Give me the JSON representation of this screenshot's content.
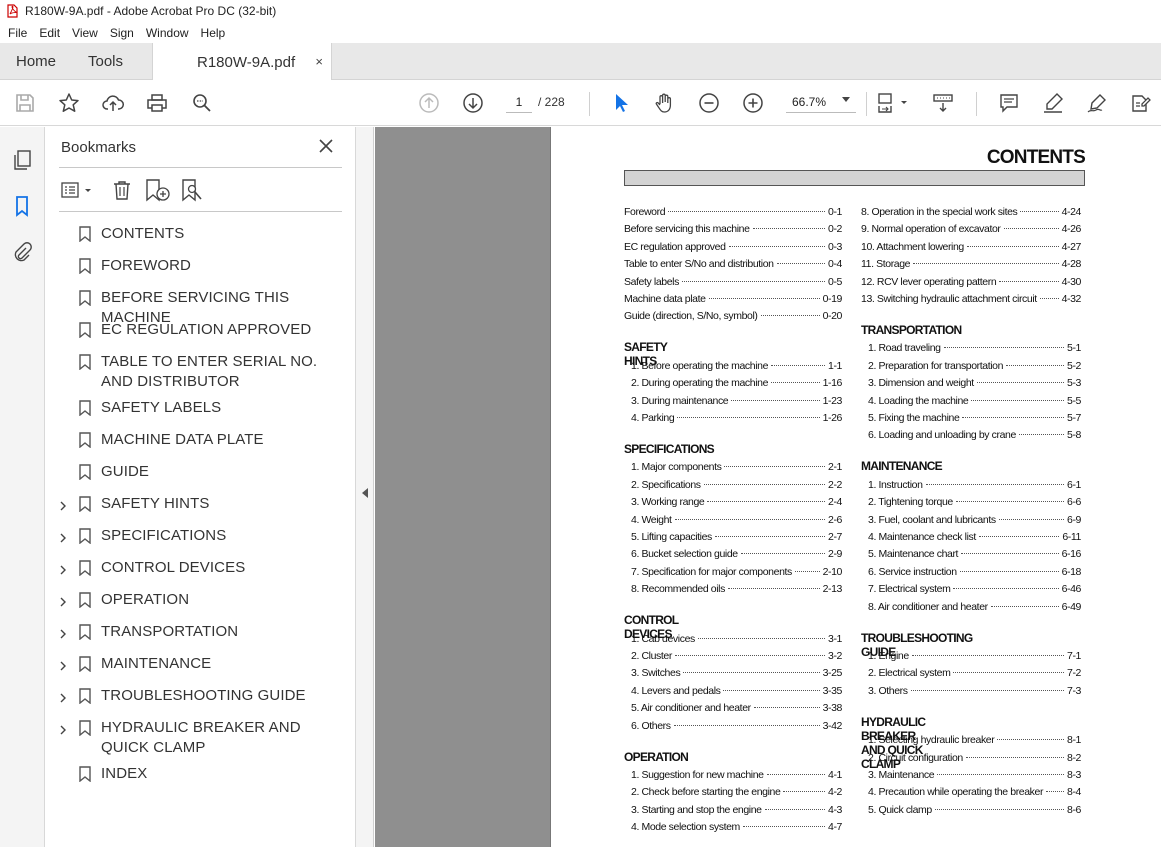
{
  "window": {
    "title": "R180W-9A.pdf - Adobe Acrobat Pro DC (32-bit)"
  },
  "menu": [
    "File",
    "Edit",
    "View",
    "Sign",
    "Window",
    "Help"
  ],
  "tabs": {
    "home": "Home",
    "tools": "Tools",
    "doc": "R180W-9A.pdf",
    "close": "×"
  },
  "toolbar": {
    "page_current": "1",
    "page_total": "/ 228",
    "zoom": "66.7%"
  },
  "bookmarks": {
    "title": "Bookmarks",
    "items": [
      {
        "label": "CONTENTS",
        "expandable": false
      },
      {
        "label": "FOREWORD",
        "expandable": false
      },
      {
        "label": "BEFORE SERVICING THIS MACHINE",
        "expandable": false
      },
      {
        "label": "EC REGULATION APPROVED",
        "expandable": false
      },
      {
        "label": "TABLE TO ENTER SERIAL NO. AND DISTRIBUTOR",
        "expandable": false
      },
      {
        "label": "SAFETY LABELS",
        "expandable": false
      },
      {
        "label": "MACHINE DATA PLATE",
        "expandable": false
      },
      {
        "label": "GUIDE",
        "expandable": false
      },
      {
        "label": "SAFETY HINTS",
        "expandable": true
      },
      {
        "label": "SPECIFICATIONS",
        "expandable": true
      },
      {
        "label": "CONTROL DEVICES",
        "expandable": true
      },
      {
        "label": "OPERATION",
        "expandable": true
      },
      {
        "label": "TRANSPORTATION",
        "expandable": true
      },
      {
        "label": "MAINTENANCE",
        "expandable": true
      },
      {
        "label": "TROUBLESHOOTING GUIDE",
        "expandable": true
      },
      {
        "label": "HYDRAULIC BREAKER AND QUICK CLAMP",
        "expandable": true
      },
      {
        "label": "INDEX",
        "expandable": false
      }
    ]
  },
  "document": {
    "title": "CONTENTS",
    "left": {
      "intro": [
        {
          "t": "Foreword",
          "p": "0-1"
        },
        {
          "t": "Before servicing this machine",
          "p": "0-2"
        },
        {
          "t": "EC regulation approved",
          "p": "0-3"
        },
        {
          "t": "Table to enter S/No and distribution",
          "p": "0-4"
        },
        {
          "t": "Safety labels",
          "p": "0-5"
        },
        {
          "t": "Machine data plate",
          "p": "0-19"
        },
        {
          "t": "Guide (direction, S/No, symbol)",
          "p": "0-20"
        }
      ],
      "sections": [
        {
          "title": "SAFETY HINTS",
          "rows": [
            {
              "t": "1. Before operating the machine",
              "p": "1-1"
            },
            {
              "t": "2. During operating the machine",
              "p": "1-16"
            },
            {
              "t": "3. During maintenance",
              "p": "1-23"
            },
            {
              "t": "4. Parking",
              "p": "1-26"
            }
          ]
        },
        {
          "title": "SPECIFICATIONS",
          "rows": [
            {
              "t": "1. Major components",
              "p": "2-1"
            },
            {
              "t": "2. Specifications",
              "p": "2-2"
            },
            {
              "t": "3. Working range",
              "p": "2-4"
            },
            {
              "t": "4. Weight",
              "p": "2-6"
            },
            {
              "t": "5. Lifting capacities",
              "p": "2-7"
            },
            {
              "t": "6. Bucket selection guide",
              "p": "2-9"
            },
            {
              "t": "7. Specification for major components",
              "p": "2-10"
            },
            {
              "t": "8. Recommended oils",
              "p": "2-13"
            }
          ]
        },
        {
          "title": "CONTROL DEVICES",
          "rows": [
            {
              "t": "1. Cab devices",
              "p": "3-1"
            },
            {
              "t": "2. Cluster",
              "p": "3-2"
            },
            {
              "t": "3. Switches",
              "p": "3-25"
            },
            {
              "t": "4. Levers and pedals",
              "p": "3-35"
            },
            {
              "t": "5. Air conditioner and heater",
              "p": "3-38"
            },
            {
              "t": "6. Others",
              "p": "3-42"
            }
          ]
        },
        {
          "title": "OPERATION",
          "rows": [
            {
              "t": "1. Suggestion for new machine",
              "p": "4-1"
            },
            {
              "t": "2. Check before starting the engine",
              "p": "4-2"
            },
            {
              "t": "3. Starting and stop the engine",
              "p": "4-3"
            },
            {
              "t": "4. Mode selection system",
              "p": "4-7"
            }
          ]
        }
      ]
    },
    "right": {
      "intro": [
        {
          "t": "8. Operation in the special work sites",
          "p": "4-24"
        },
        {
          "t": "9. Normal operation of excavator",
          "p": "4-26"
        },
        {
          "t": "10. Attachment lowering",
          "p": "4-27"
        },
        {
          "t": "11. Storage",
          "p": "4-28"
        },
        {
          "t": "12. RCV lever operating pattern",
          "p": "4-30"
        },
        {
          "t": "13. Switching hydraulic attachment circuit",
          "p": "4-32"
        }
      ],
      "sections": [
        {
          "title": "TRANSPORTATION",
          "rows": [
            {
              "t": "1. Road traveling",
              "p": "5-1"
            },
            {
              "t": "2. Preparation for transportation",
              "p": "5-2"
            },
            {
              "t": "3. Dimension and weight",
              "p": "5-3"
            },
            {
              "t": "4. Loading the machine",
              "p": "5-5"
            },
            {
              "t": "5. Fixing the machine",
              "p": "5-7"
            },
            {
              "t": "6. Loading and unloading by crane",
              "p": "5-8"
            }
          ]
        },
        {
          "title": "MAINTENANCE",
          "rows": [
            {
              "t": "1. Instruction",
              "p": "6-1"
            },
            {
              "t": "2. Tightening torque",
              "p": "6-6"
            },
            {
              "t": "3. Fuel, coolant and lubricants",
              "p": "6-9"
            },
            {
              "t": "4. Maintenance check list",
              "p": "6-11"
            },
            {
              "t": "5. Maintenance chart",
              "p": "6-16"
            },
            {
              "t": "6. Service instruction",
              "p": "6-18"
            },
            {
              "t": "7. Electrical system",
              "p": "6-46"
            },
            {
              "t": "8. Air conditioner and heater",
              "p": "6-49"
            }
          ]
        },
        {
          "title": "TROUBLESHOOTING GUIDE",
          "rows": [
            {
              "t": "1. Engine",
              "p": "7-1"
            },
            {
              "t": "2. Electrical system",
              "p": "7-2"
            },
            {
              "t": "3. Others",
              "p": "7-3"
            }
          ]
        },
        {
          "title": "HYDRAULIC BREAKER AND QUICK CLAMP",
          "rows": [
            {
              "t": "1. Selecting hydraulic breaker",
              "p": "8-1"
            },
            {
              "t": "2. Circuit configuration",
              "p": "8-2"
            },
            {
              "t": "3. Maintenance",
              "p": "8-3"
            },
            {
              "t": "4. Precaution while operating the breaker",
              "p": "8-4"
            },
            {
              "t": "5. Quick clamp",
              "p": "8-6"
            }
          ]
        }
      ]
    }
  }
}
